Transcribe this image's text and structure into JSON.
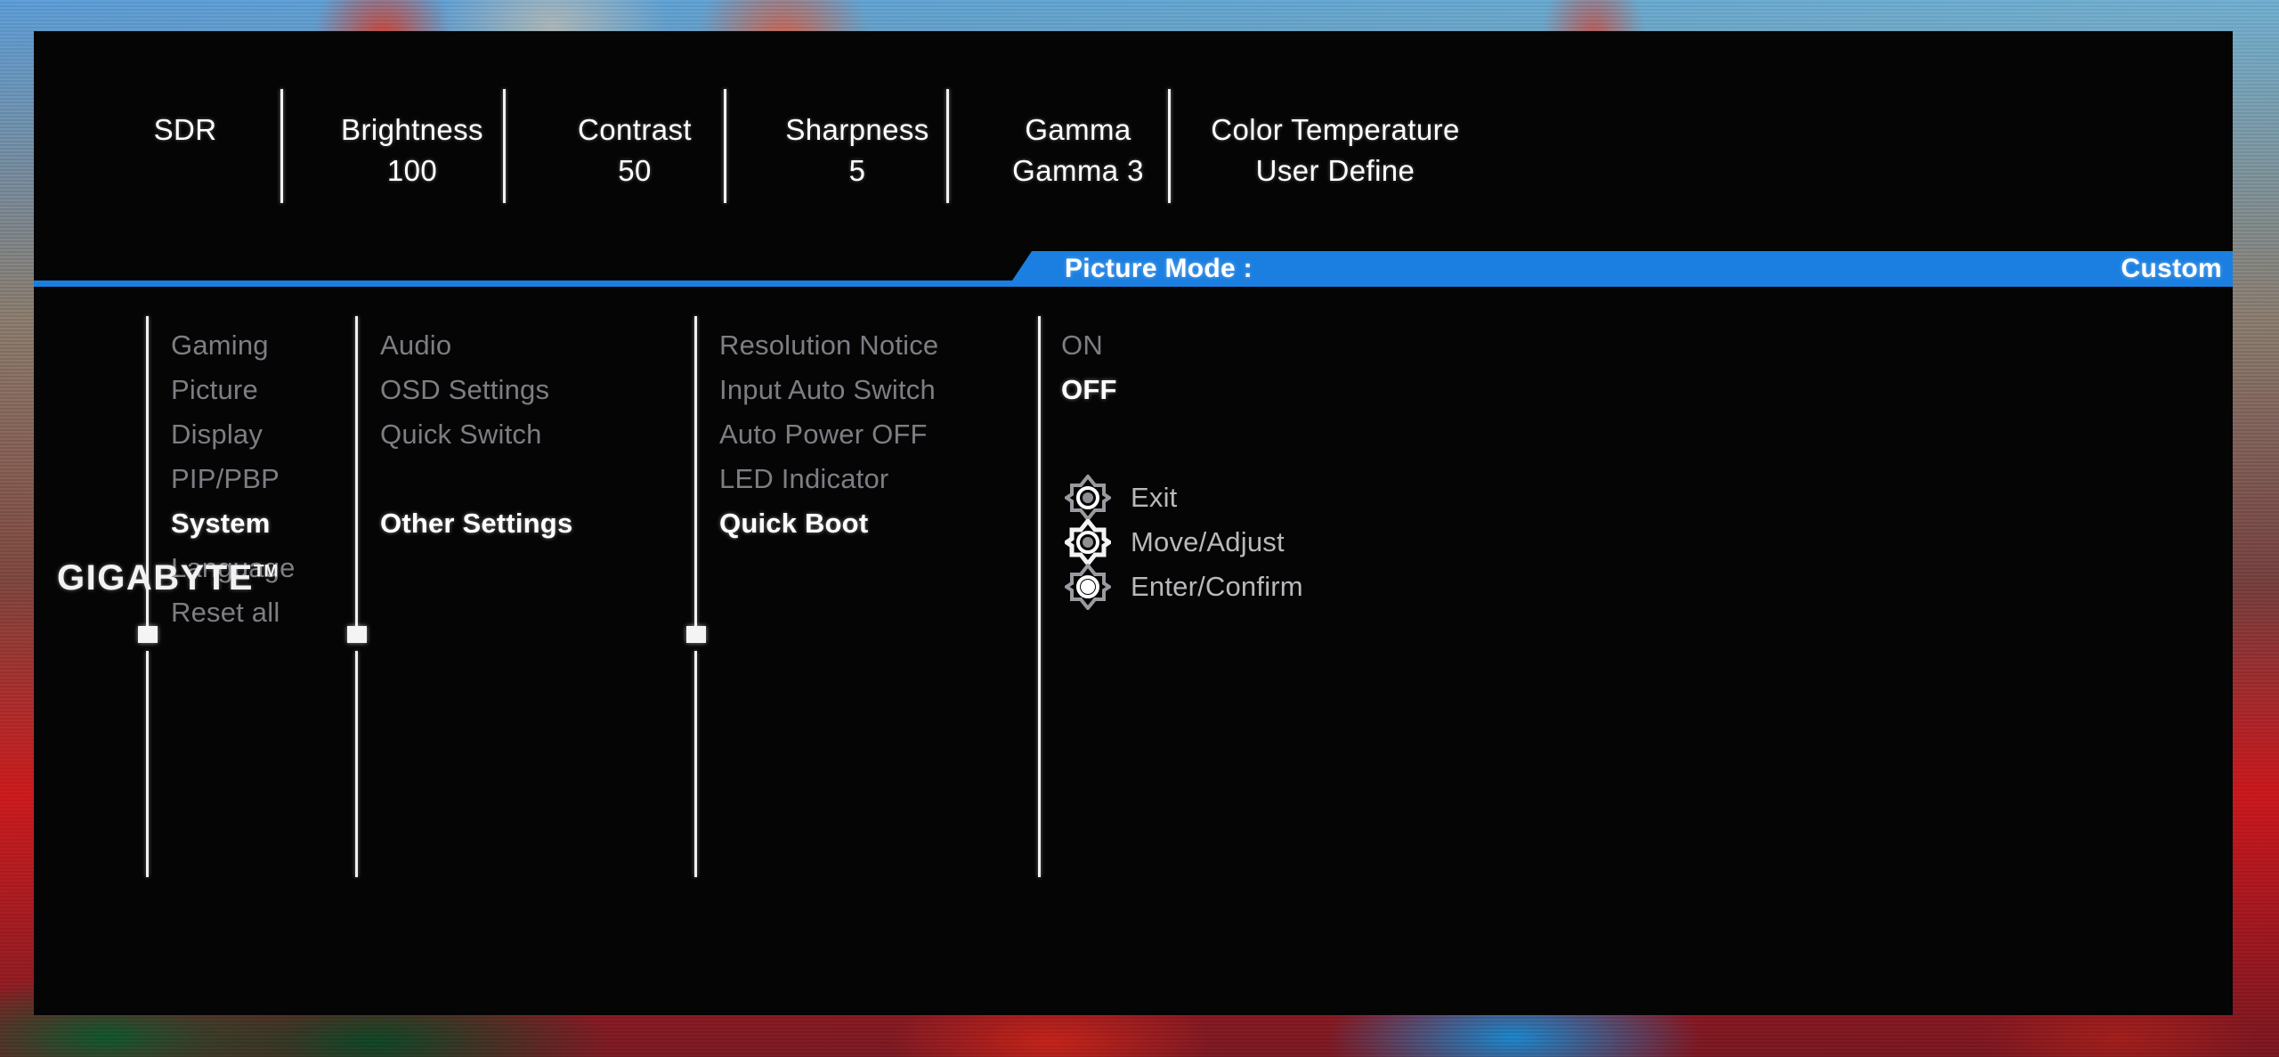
{
  "colors": {
    "accent_blue": "#1a7fe0",
    "panel_bg": "#050505",
    "text_dim": "#7d7d84",
    "text_active": "#ffffff",
    "rule": "#f0f0f0",
    "scrollbar_cyan": "#13b6e8"
  },
  "header": {
    "items": [
      {
        "label": "SDR",
        "value": ""
      },
      {
        "label": "Brightness",
        "value": "100"
      },
      {
        "label": "Contrast",
        "value": "50"
      },
      {
        "label": "Sharpness",
        "value": "5"
      },
      {
        "label": "Gamma",
        "value": "Gamma 3"
      },
      {
        "label": "Color Temperature",
        "value": "User Define"
      }
    ]
  },
  "picture_mode": {
    "label": "Picture Mode  :",
    "value": "Custom"
  },
  "menu": {
    "column1": {
      "name": "root-menu",
      "items": [
        {
          "label": "Gaming",
          "selected": false
        },
        {
          "label": "Picture",
          "selected": false
        },
        {
          "label": "Display",
          "selected": false
        },
        {
          "label": "PIP/PBP",
          "selected": false
        },
        {
          "label": "System",
          "selected": true
        },
        {
          "label": "Language",
          "selected": false
        },
        {
          "label": "Reset all",
          "selected": false
        }
      ]
    },
    "column2": {
      "name": "system-submenu",
      "items": [
        {
          "label": "Audio",
          "selected": false
        },
        {
          "label": "OSD Settings",
          "selected": false
        },
        {
          "label": "Quick Switch",
          "selected": false
        },
        {
          "label": "Other Settings",
          "selected": true
        }
      ]
    },
    "column3": {
      "name": "other-settings-submenu",
      "items": [
        {
          "label": "Resolution Notice",
          "selected": false
        },
        {
          "label": "Input Auto Switch",
          "selected": false
        },
        {
          "label": "Auto Power OFF",
          "selected": false
        },
        {
          "label": "LED Indicator",
          "selected": false
        },
        {
          "label": "Quick Boot",
          "selected": true
        }
      ]
    },
    "column4": {
      "name": "quick-boot-values",
      "items": [
        {
          "label": "ON",
          "selected": false
        },
        {
          "label": "OFF",
          "selected": true
        }
      ]
    }
  },
  "legend": {
    "items": [
      {
        "label": "Exit",
        "icon": "joystick-press-icon"
      },
      {
        "label": "Move/Adjust",
        "icon": "joystick-move-icon"
      },
      {
        "label": "Enter/Confirm",
        "icon": "joystick-enter-icon"
      }
    ]
  },
  "brand": {
    "name": "GIGABYTE",
    "tm": "TM"
  }
}
